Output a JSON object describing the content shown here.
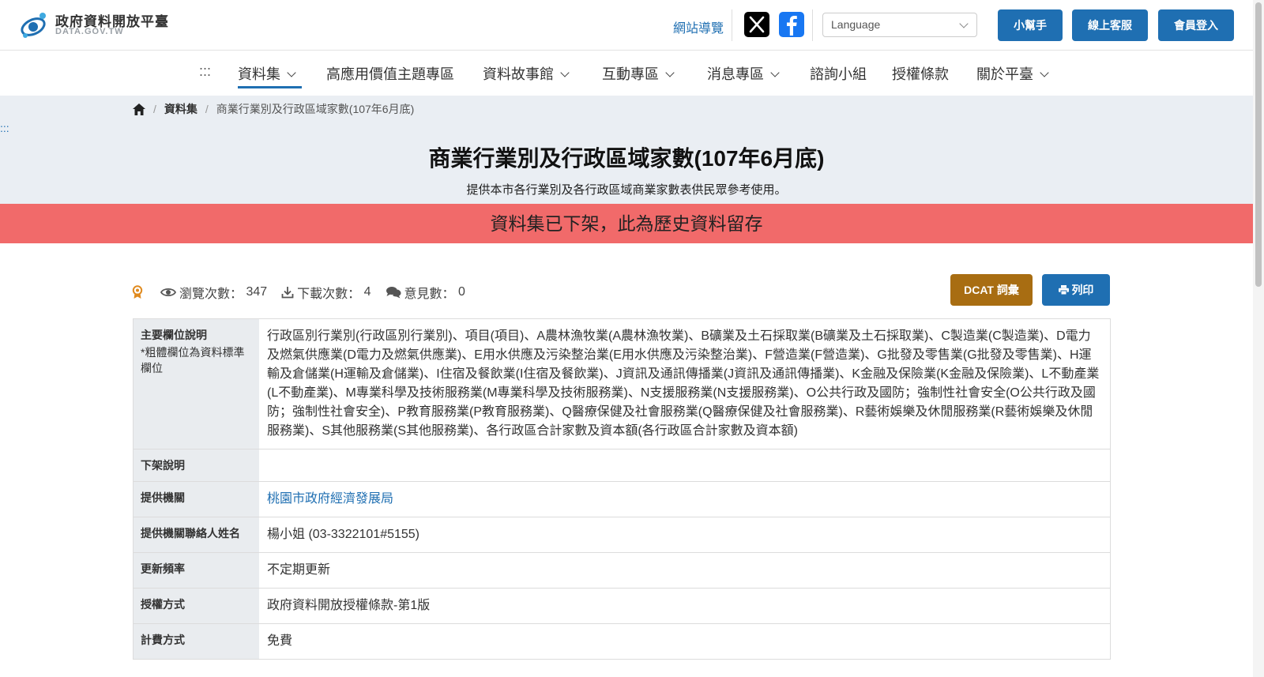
{
  "header": {
    "logo_title": "政府資料開放平臺",
    "logo_sub": "DATA.GOV.TW",
    "sitemap": "網站導覽",
    "language_placeholder": "Language",
    "buttons": [
      "小幫手",
      "線上客服",
      "會員登入"
    ]
  },
  "nav": {
    "accesskey": ":::",
    "items": [
      "資料集",
      "高應用價值主題專區",
      "資料故事館",
      "互動專區",
      "消息專區",
      "諮詢小組",
      "授權條款",
      "關於平臺"
    ]
  },
  "breadcrumb": {
    "items": [
      "資料集",
      "商業行業別及行政區域家數(107年6月底)"
    ]
  },
  "page": {
    "accesskey": ":::",
    "title": "商業行業別及行政區域家數(107年6月底)",
    "description": "提供本市各行業別及各行政區域商業家數表供民眾參考使用。",
    "banner": "資料集已下架，此為歷史資料留存"
  },
  "stats": {
    "views_label": "瀏覽次數：",
    "views": "347",
    "downloads_label": "下載次數：",
    "downloads": "4",
    "comments_label": "意見數：",
    "comments": "0"
  },
  "actions": {
    "dcat": "DCAT 詞彙",
    "print": "列印"
  },
  "details": {
    "fields_label": "主要欄位說明",
    "fields_note": "*粗體欄位為資料標準欄位",
    "fields_value": "行政區別行業別(行政區別行業別)、項目(項目)、A農林漁牧業(A農林漁牧業)、B礦業及土石採取業(B礦業及土石採取業)、C製造業(C製造業)、D電力及燃氣供應業(D電力及燃氣供應業)、E用水供應及污染整治業(E用水供應及污染整治業)、F營造業(F營造業)、G批發及零售業(G批發及零售業)、H運輸及倉儲業(H運輸及倉儲業)、I住宿及餐飲業(I住宿及餐飲業)、J資訊及通訊傳播業(J資訊及通訊傳播業)、K金融及保險業(K金融及保險業)、L不動產業(L不動產業)、M專業科學及技術服務業(M專業科學及技術服務業)、N支援服務業(N支援服務業)、O公共行政及國防；強制性社會安全(O公共行政及國防；強制性社會安全)、P教育服務業(P教育服務業)、Q醫療保健及社會服務業(Q醫療保健及社會服務業)、R藝術娛樂及休閒服務業(R藝術娛樂及休閒服務業)、S其他服務業(S其他服務業)、各行政區合計家數及資本額(各行政區合計家數及資本額)",
    "removal_label": "下架說明",
    "removal_value": "",
    "agency_label": "提供機關",
    "agency_value": "桃園市政府經濟發展局",
    "contact_label": "提供機關聯絡人姓名",
    "contact_value": "楊小姐 (03-3322101#5155)",
    "frequency_label": "更新頻率",
    "frequency_value": "不定期更新",
    "license_label": "授權方式",
    "license_value": "政府資料開放授權條款-第1版",
    "fee_label": "計費方式",
    "fee_value": "免費"
  },
  "colors": {
    "primary": "#1f6fb2",
    "dcat": "#a86d12",
    "banner": "#f16a6a",
    "hero_bg": "#eaeef3"
  }
}
